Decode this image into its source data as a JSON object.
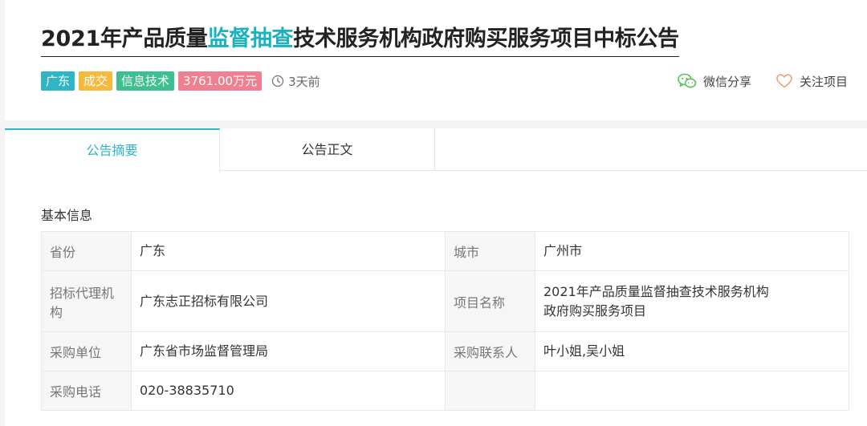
{
  "notice": {
    "title_before": "2021年产品质量",
    "title_highlight": "监督抽查",
    "title_after": "技术服务机构政府购买服务项目中标公告",
    "tags": {
      "region": "广东",
      "status": "成交",
      "category": "信息技术",
      "amount": "3761.00万元"
    },
    "time": "3天前",
    "time_icon": "clock-icon"
  },
  "actions": {
    "share_label": "微信分享",
    "share_icon": "wechat-icon",
    "follow_label": "关注项目",
    "follow_icon": "heart-icon"
  },
  "tabs": {
    "summary": "公告摘要",
    "body": "公告正文"
  },
  "basic_info": {
    "section_title": "基本信息",
    "province_label": "省份",
    "province": "广东",
    "city_label": "城市",
    "city": "广州市",
    "agency_label": "招标代理机构",
    "agency": "广东志正招标有限公司",
    "project_label": "项目名称",
    "project_line1": "2021年产品质量监督抽查技术服务机构",
    "project_line2": "政府购买服务项目",
    "buyer_label": "采购单位",
    "buyer": "广东省市场监督管理局",
    "contact_label": "采购联系人",
    "contact": "叶小姐,吴小姐",
    "phone_label": "采购电话",
    "phone": "020-38835710"
  },
  "colors": {
    "accent": "#2eb6c7",
    "highlight": "#19b3c0",
    "tag_region": "#2eb6c7",
    "tag_status": "#f6b93b",
    "tag_category": "#3cc08f",
    "tag_amount": "#f0808f",
    "wechat": "#5cc05c",
    "heart": "#f0a07a"
  }
}
